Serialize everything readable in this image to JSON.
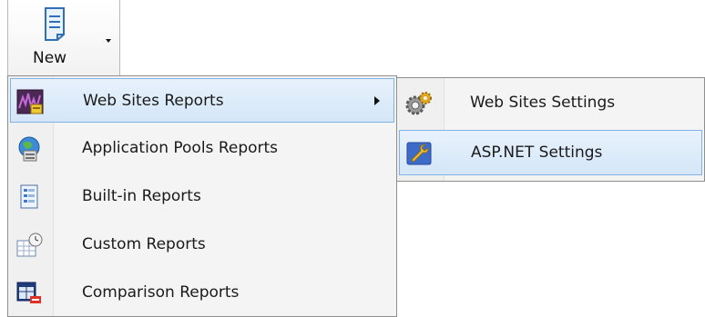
{
  "toolbar": {
    "new_label": "New",
    "new_icon": "new-document-icon",
    "dropdown_icon": "chevron-down-icon"
  },
  "menu": {
    "items": [
      {
        "label": "Web Sites Reports",
        "icon": "web-sites-reports-icon",
        "has_submenu": true,
        "highlighted": true
      },
      {
        "label": "Application Pools Reports",
        "icon": "application-pools-icon",
        "has_submenu": false
      },
      {
        "label": "Built-in Reports",
        "icon": "built-in-reports-icon",
        "has_submenu": false
      },
      {
        "label": "Custom Reports",
        "icon": "custom-reports-icon",
        "has_submenu": false
      },
      {
        "label": "Comparison Reports",
        "icon": "comparison-reports-icon",
        "has_submenu": false
      }
    ]
  },
  "submenu": {
    "items": [
      {
        "label": "Web Sites Settings",
        "icon": "gears-icon"
      },
      {
        "label": "ASP.NET Settings",
        "icon": "wrench-icon",
        "highlighted": true
      }
    ]
  },
  "colors": {
    "highlight_border": "#7fb3e6",
    "highlight_fill": "#d4e6f8",
    "menu_background": "#f4f4f4"
  }
}
